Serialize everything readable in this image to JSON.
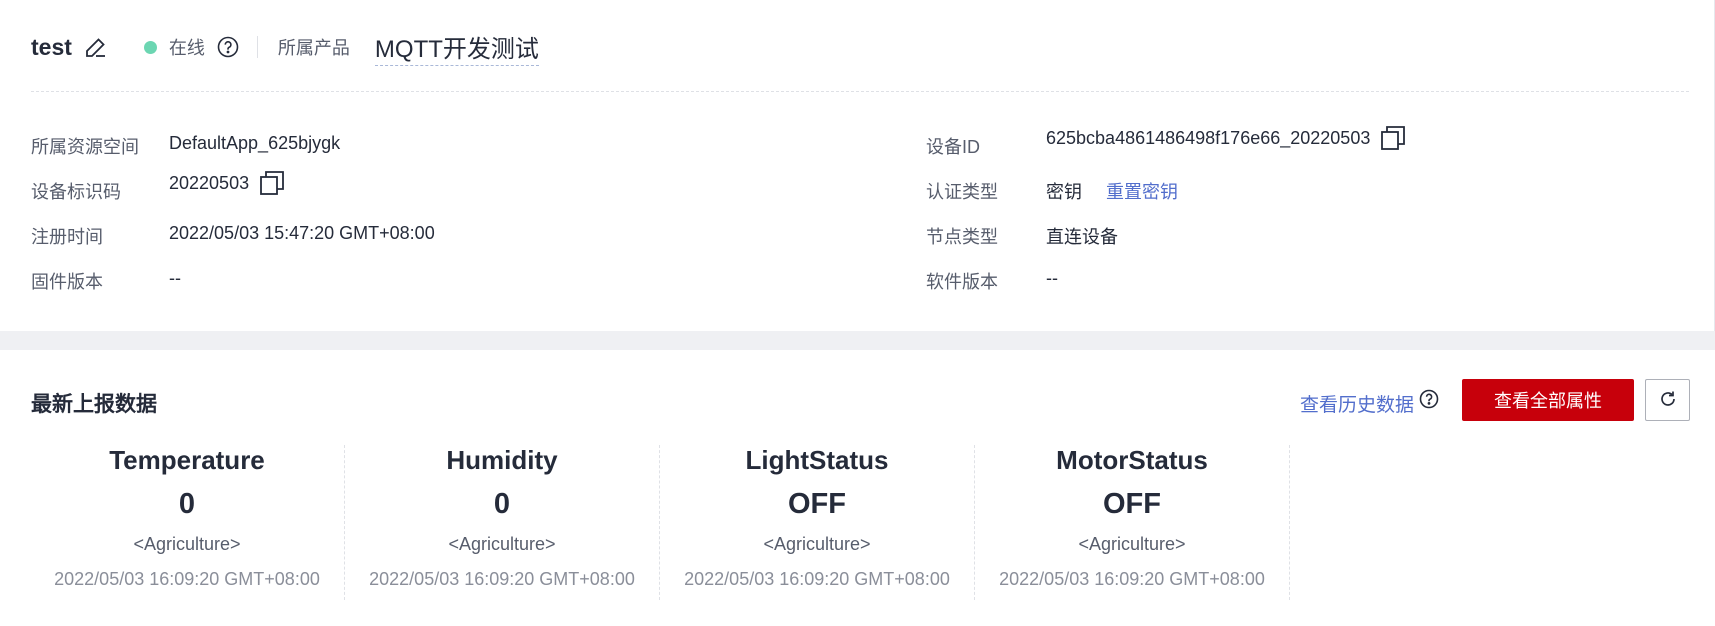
{
  "header": {
    "device_name": "test",
    "status": "在线",
    "product_label": "所属产品",
    "product_name": "MQTT开发测试"
  },
  "info": {
    "left": [
      {
        "label": "所属资源空间",
        "value": "DefaultApp_625bjygk"
      },
      {
        "label": "设备标识码",
        "value": "20220503"
      },
      {
        "label": "注册时间",
        "value": "2022/05/03 15:47:20 GMT+08:00"
      },
      {
        "label": "固件版本",
        "value": "--"
      }
    ],
    "right": [
      {
        "label": "设备ID",
        "value": "625bcba4861486498f176e66_20220503"
      },
      {
        "label": "认证类型",
        "value": "密钥",
        "action": "重置密钥"
      },
      {
        "label": "节点类型",
        "value": "直连设备"
      },
      {
        "label": "软件版本",
        "value": "--"
      }
    ]
  },
  "latest": {
    "title": "最新上报数据",
    "history_link": "查看历史数据",
    "view_all_button": "查看全部属性",
    "metrics": [
      {
        "name": "Temperature",
        "value": "0",
        "service": "<Agriculture>",
        "time": "2022/05/03 16:09:20 GMT+08:00"
      },
      {
        "name": "Humidity",
        "value": "0",
        "service": "<Agriculture>",
        "time": "2022/05/03 16:09:20 GMT+08:00"
      },
      {
        "name": "LightStatus",
        "value": "OFF",
        "service": "<Agriculture>",
        "time": "2022/05/03 16:09:20 GMT+08:00"
      },
      {
        "name": "MotorStatus",
        "value": "OFF",
        "service": "<Agriculture>",
        "time": "2022/05/03 16:09:20 GMT+08:00"
      }
    ]
  },
  "colors": {
    "online": "#6cd6b2",
    "primary_button": "#c7000b",
    "link": "#526ecc"
  },
  "icons": [
    "edit-icon",
    "help-icon",
    "copy-icon",
    "refresh-icon"
  ]
}
